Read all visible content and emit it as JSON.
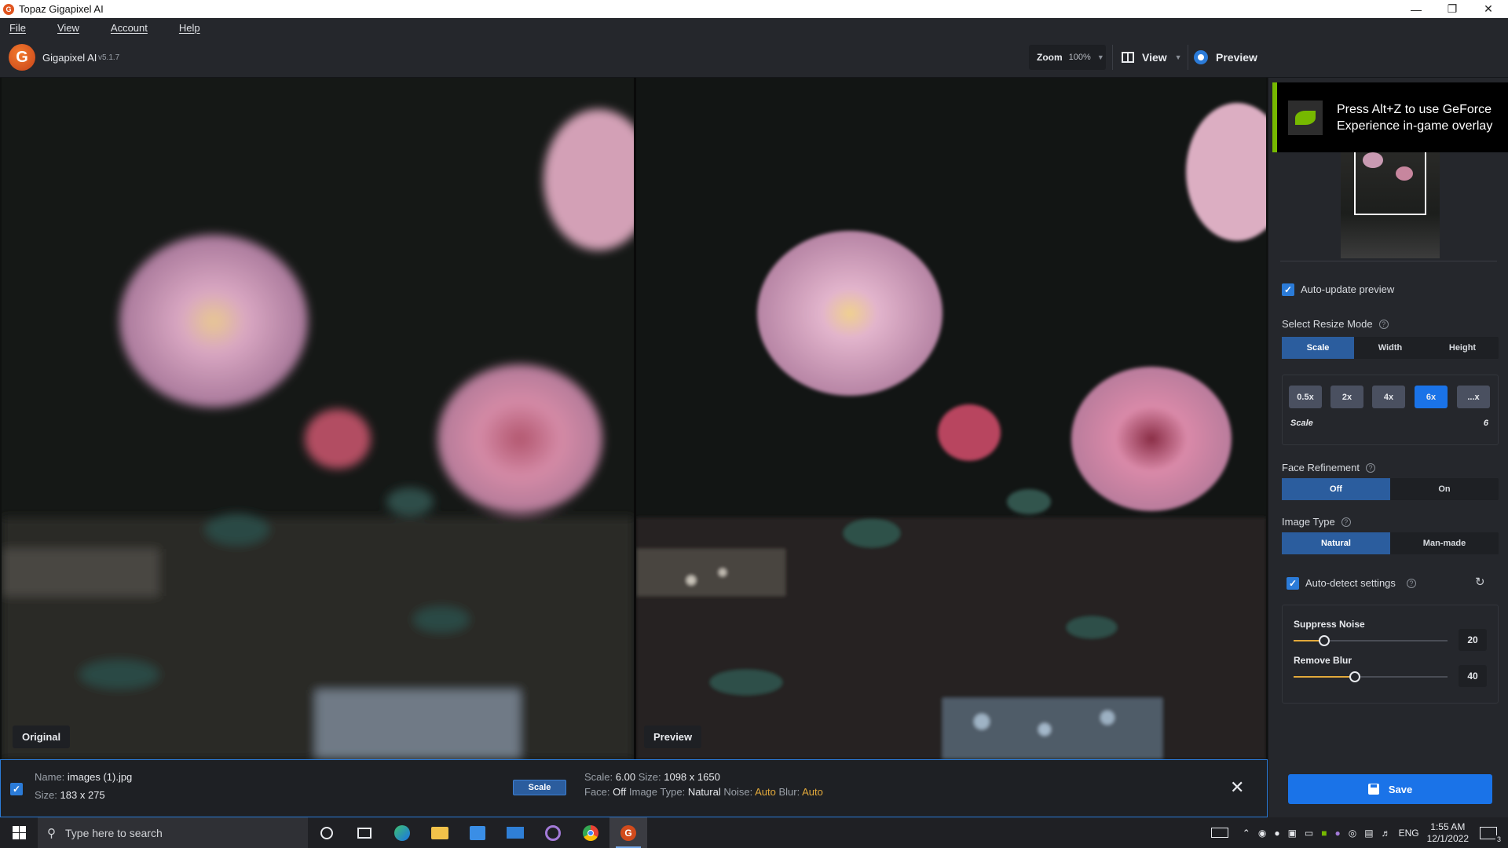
{
  "window": {
    "title": "Topaz Gigapixel AI"
  },
  "menu": [
    "File",
    "View",
    "Account",
    "Help"
  ],
  "header": {
    "app_name": "Gigapixel AI",
    "version": "v5.1.7",
    "zoom_label": "Zoom",
    "zoom_value": "100%",
    "view_label": "View",
    "preview_label": "Preview"
  },
  "viewport": {
    "original_label": "Original",
    "preview_label": "Preview"
  },
  "overlay": {
    "text": "Press Alt+Z to use GeForce Experience in-game overlay"
  },
  "panel": {
    "auto_update": {
      "label": "Auto-update preview",
      "checked": true
    },
    "resize_mode": {
      "label": "Select Resize Mode",
      "options": [
        "Scale",
        "Width",
        "Height"
      ],
      "selected": "Scale"
    },
    "scale_buttons": [
      "0.5x",
      "2x",
      "4x",
      "6x",
      "...x"
    ],
    "scale_selected": "6x",
    "scale_label": "Scale",
    "scale_value": "6",
    "face_refinement": {
      "label": "Face Refinement",
      "options": [
        "Off",
        "On"
      ],
      "selected": "Off"
    },
    "image_type": {
      "label": "Image Type",
      "options": [
        "Natural",
        "Man-made"
      ],
      "selected": "Natural"
    },
    "auto_detect": {
      "label": "Auto-detect settings",
      "checked": true
    },
    "suppress_noise": {
      "label": "Suppress Noise",
      "value": "20",
      "level": 20
    },
    "remove_blur": {
      "label": "Remove Blur",
      "value": "40",
      "level": 40
    },
    "save_label": "Save"
  },
  "infobar": {
    "name_key": "Name:",
    "name_value": "images (1).jpg",
    "size_key": "Size:",
    "size_value": "183 x 275",
    "tag": "Scale",
    "scale_key": "Scale:",
    "scale_value": "6.00",
    "out_size_key": "Size:",
    "out_size_value": "1098 x 1650",
    "face_key": "Face:",
    "face_value": "Off",
    "type_key": "Image Type:",
    "type_value": "Natural",
    "noise_key": "Noise:",
    "noise_value": "Auto",
    "blur_key": "Blur:",
    "blur_value": "Auto"
  },
  "taskbar": {
    "search_placeholder": "Type here to search",
    "language": "ENG",
    "time": "1:55 AM",
    "date": "12/1/2022",
    "notification_count": "3"
  }
}
